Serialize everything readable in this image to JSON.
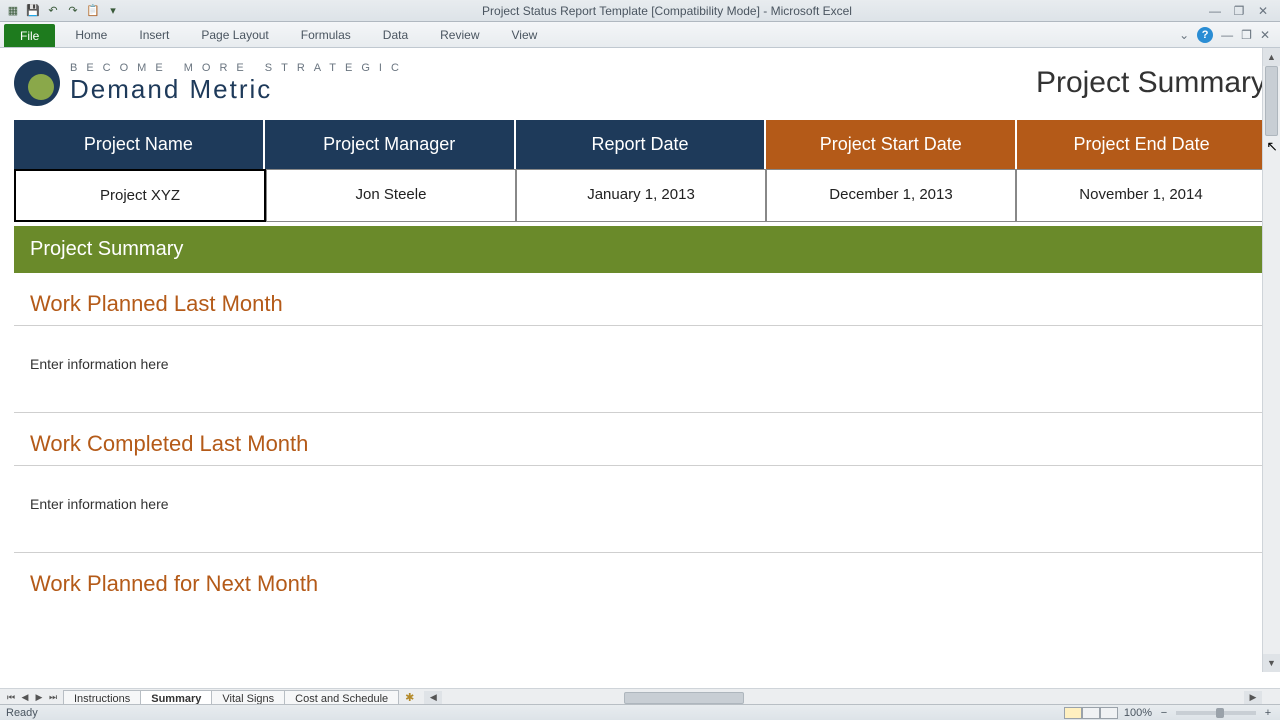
{
  "titlebar": {
    "title": "Project Status Report Template  [Compatibility Mode]  -  Microsoft Excel"
  },
  "ribbon": {
    "file": "File",
    "tabs": [
      "Home",
      "Insert",
      "Page Layout",
      "Formulas",
      "Data",
      "Review",
      "View"
    ]
  },
  "logo": {
    "tagline": "Become More Strategic",
    "name": "Demand Metric"
  },
  "page_title": "Project Summary",
  "header_table": {
    "cols": [
      {
        "label": "Project Name",
        "style": "navy"
      },
      {
        "label": "Project Manager",
        "style": "navy"
      },
      {
        "label": "Report Date",
        "style": "navy"
      },
      {
        "label": "Project Start Date",
        "style": "orange"
      },
      {
        "label": "Project End Date",
        "style": "orange"
      }
    ],
    "row": [
      "Project XYZ",
      "Jon Steele",
      "January 1, 2013",
      "December 1, 2013",
      "November 1, 2014"
    ]
  },
  "section_bar": "Project Summary",
  "sections": [
    {
      "heading": "Work Planned Last Month",
      "body": "Enter information here"
    },
    {
      "heading": "Work Completed Last Month",
      "body": "Enter information here"
    },
    {
      "heading": "Work Planned for Next Month",
      "body": ""
    }
  ],
  "sheet_tabs": {
    "tabs": [
      "Instructions",
      "Summary",
      "Vital Signs",
      "Cost and Schedule"
    ],
    "active": "Summary"
  },
  "statusbar": {
    "status": "Ready",
    "zoom": "100%"
  }
}
